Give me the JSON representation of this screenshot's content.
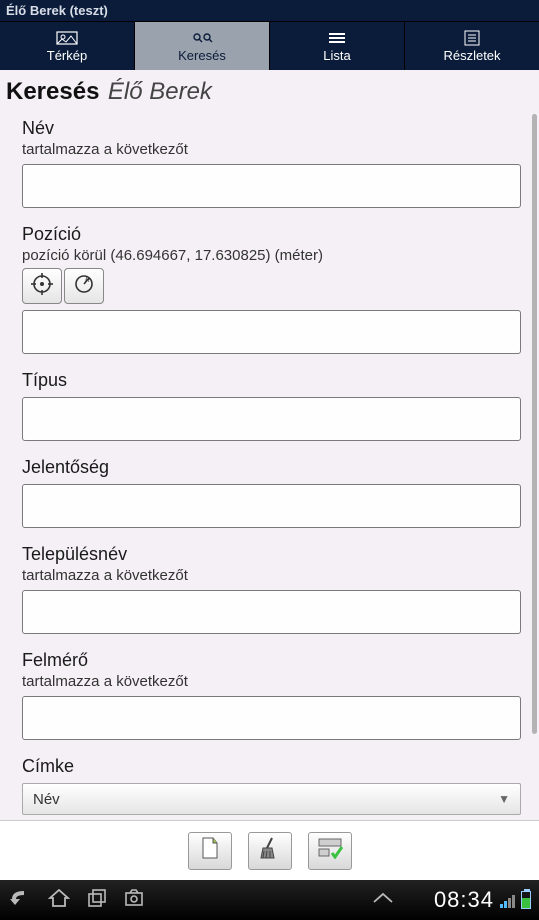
{
  "app_title": "Élő Berek (teszt)",
  "tabs": {
    "map": "Térkép",
    "search": "Keresés",
    "list": "Lista",
    "details": "Részletek"
  },
  "page": {
    "title": "Keresés",
    "subtitle": "Élő Berek"
  },
  "fields": {
    "name": {
      "label": "Név",
      "sub": "tartalmazza a következőt",
      "value": ""
    },
    "position": {
      "label": "Pozíció",
      "sub": "pozíció körül (46.694667, 17.630825) (méter)",
      "value": ""
    },
    "type": {
      "label": "Típus",
      "value": ""
    },
    "importance": {
      "label": "Jelentőség",
      "value": ""
    },
    "settlement": {
      "label": "Településnév",
      "sub": "tartalmazza a következőt",
      "value": ""
    },
    "surveyor": {
      "label": "Felmérő",
      "sub": "tartalmazza a következőt",
      "value": ""
    },
    "tag": {
      "label": "Címke",
      "selected": "Név"
    }
  },
  "statusbar": {
    "time": "08:34"
  }
}
